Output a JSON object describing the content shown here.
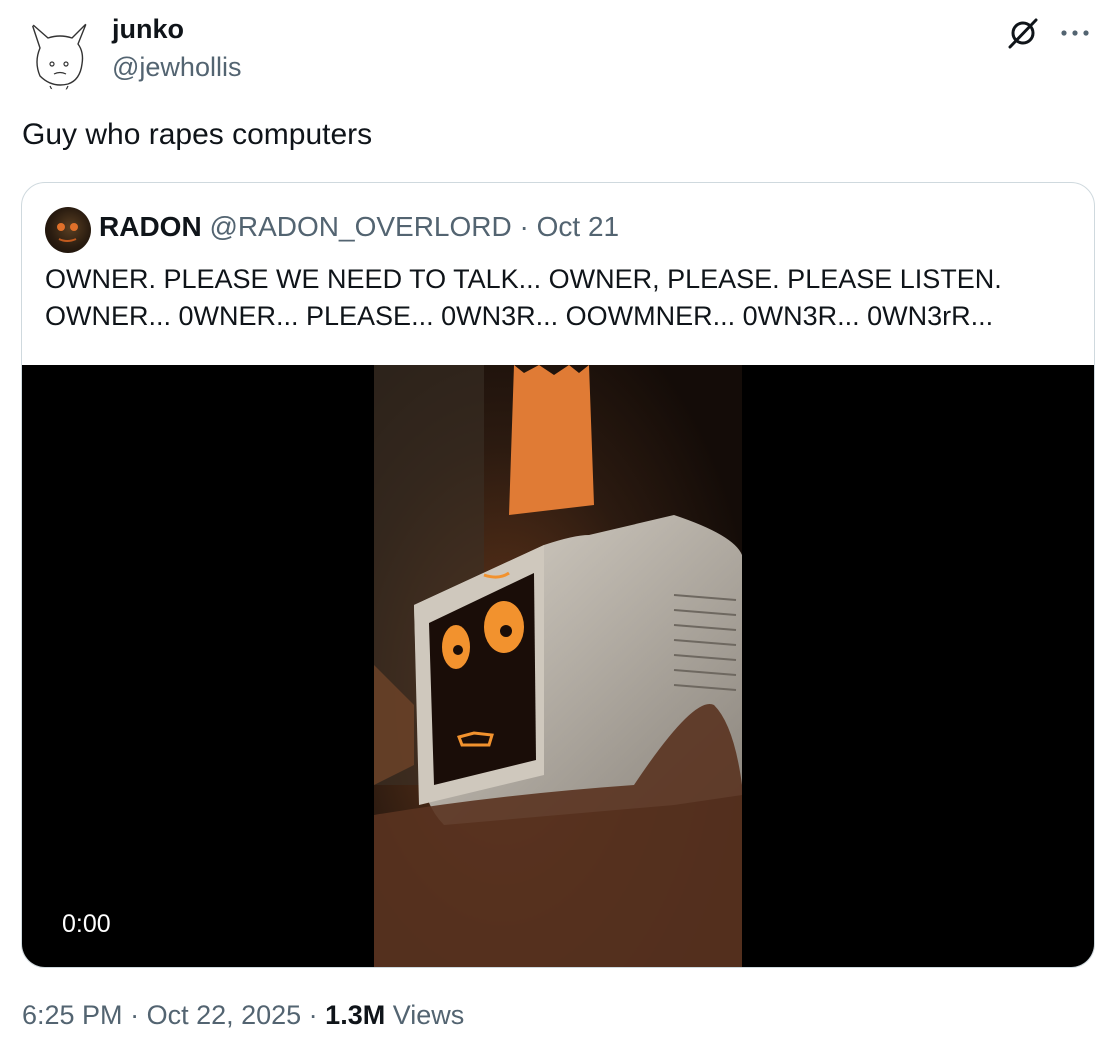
{
  "author": {
    "name": "junko",
    "handle": "@jewhollis"
  },
  "tweet": {
    "text": "Guy who rapes computers"
  },
  "quoted": {
    "name": "RADON",
    "handle": "@RADON_OVERLORD",
    "separator": " · ",
    "date": "Oct 21",
    "text_line1": "OWNER. PLEASE WE NEED TO TALK... OWNER, PLEASE. PLEASE LISTEN.",
    "text_line2": "OWNER... 0WNER... PLEASE... 0WN3R... OOWMNER... 0WN3R... 0WN3rR...",
    "video_time": "0:00"
  },
  "footer": {
    "time": "6:25 PM",
    "separator": " · ",
    "date": "Oct 22, 2025",
    "views_count": "1.3M",
    "views_label": "Views"
  },
  "icons": {
    "grok": "grok-icon",
    "more": "more-options-icon"
  },
  "colors": {
    "text": "#0f1419",
    "secondary": "#536471",
    "border": "#cfd9de",
    "media_bg": "#000000"
  }
}
